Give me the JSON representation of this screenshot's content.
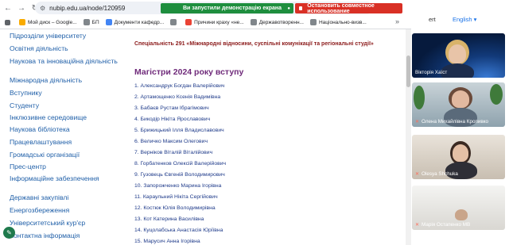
{
  "browser": {
    "url": "nubip.edu.ua/node/120959",
    "share_message": "Ви запустили демонстрацію екрана",
    "stop_share_label": "Остановить совместное использование",
    "bookmarks": [
      {
        "label": "",
        "icon": "apps-grid-icon"
      },
      {
        "label": "Мой диск – Google...",
        "icon": "google-drive-icon"
      },
      {
        "label": "БП",
        "icon": "folder-icon"
      },
      {
        "label": "Документи кафедр...",
        "icon": "docs-icon"
      },
      {
        "label": "",
        "icon": "folder-icon"
      },
      {
        "label": "Причини краху «не...",
        "icon": "youtube-icon"
      },
      {
        "label": "Державотворенн...",
        "icon": "folder-icon"
      },
      {
        "label": "Національно-визв...",
        "icon": "folder-icon"
      }
    ]
  },
  "right_strip": {
    "partial_text": "ert",
    "language": "English ▾"
  },
  "sidebar": {
    "items": [
      "Підрозділи університету",
      "Освітня діяльність",
      "Наукова та інноваційна діяльність",
      "Міжнародна діяльність",
      "Вступнику",
      "Студенту",
      "Інклюзивне середовище",
      "Наукова бібліотека",
      "Працевлаштування",
      "Громадські організації",
      "Прес-центр",
      "Інформаційне забезпечення",
      "Державні закупівлі",
      "Енергозбереження",
      "Університетський кур'єр",
      "Контактна інформація"
    ]
  },
  "main": {
    "specialty": "Спеціальність 291 «Міжнародні відносини, суспільні комунікації та регіональні студії»",
    "heading": "Магістри 2024 року вступу",
    "graduates": [
      "1. Александрук Богдан Валерійович",
      "2. Артамощенко Ксенія Вадимівна",
      "3. Бабаєв Рустам Ібрагімович",
      "4. Бикодір Нікіта Ярославович",
      "5. Брижицький Ілля Владиславович",
      "6. Величко Максим Олегович",
      "7. Верніков Віталій Віталійович",
      "8. Горбатенков Олексій Валерійович",
      "9. Гузовець Євгеній Володимирович",
      "10. Запорожченко Марина Ігорівна",
      "11. Караульний Нікіта Сергійович",
      "12. Костюк Юлія Володимирівна",
      "13. Кот Катерина Василівна",
      "14. Куцолабська Анастасія Юріївна",
      "15. Марусич Анна Ігорівна"
    ]
  },
  "video_tiles": [
    {
      "name": "Вікторія Хаїст",
      "muted": false
    },
    {
      "name": "Олена Михайлівна Кропивко",
      "muted": true
    },
    {
      "name": "Olesya Shchuka",
      "muted": true
    },
    {
      "name": "Марія Остапенко МВ",
      "muted": true
    }
  ]
}
